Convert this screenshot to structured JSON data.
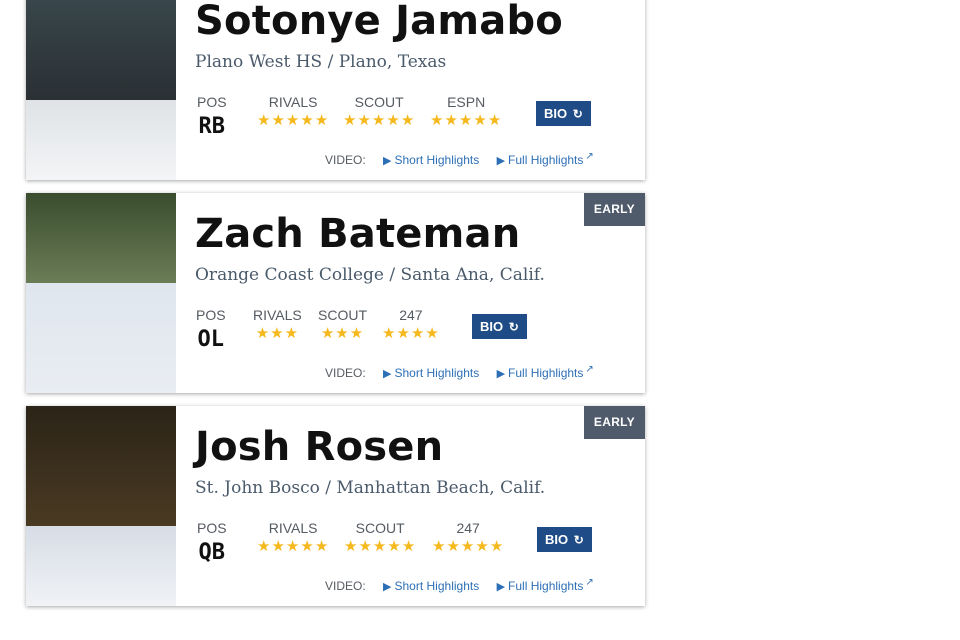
{
  "colors": {
    "badge_bg": "#4f5b6b",
    "bio_bg": "#1f4c87",
    "star": "#f5b81d",
    "link": "#2d6fb6",
    "school_text": "#4a5a6b"
  },
  "icons": {
    "star": "★",
    "refresh": "↻",
    "video_camera": "▶",
    "external_link": "↗"
  },
  "video_label": "VIDEO:",
  "players": [
    {
      "name": "Sotonye Jamabo",
      "school": "Plano West HS / Plano, Texas",
      "badge": "",
      "pos_label": "POS",
      "pos": "RB",
      "ratings": [
        {
          "label": "RIVALS",
          "stars": 5
        },
        {
          "label": "SCOUT",
          "stars": 5
        },
        {
          "label": "ESPN",
          "stars": 5
        }
      ],
      "bio_label": "BIO",
      "short_highlights": "Short Highlights",
      "full_highlights": "Full Highlights"
    },
    {
      "name": "Zach Bateman",
      "school": "Orange Coast College / Santa Ana, Calif.",
      "badge": "EARLY",
      "pos_label": "POS",
      "pos": "OL",
      "ratings": [
        {
          "label": "RIVALS",
          "stars": 3
        },
        {
          "label": "SCOUT",
          "stars": 3
        },
        {
          "label": "247",
          "stars": 4
        }
      ],
      "bio_label": "BIO",
      "short_highlights": "Short Highlights",
      "full_highlights": "Full Highlights"
    },
    {
      "name": "Josh Rosen",
      "school": "St. John Bosco / Manhattan Beach, Calif.",
      "badge": "EARLY",
      "pos_label": "POS",
      "pos": "QB",
      "ratings": [
        {
          "label": "RIVALS",
          "stars": 5
        },
        {
          "label": "SCOUT",
          "stars": 5
        },
        {
          "label": "247",
          "stars": 5
        }
      ],
      "bio_label": "BIO",
      "short_highlights": "Short Highlights",
      "full_highlights": "Full Highlights"
    }
  ]
}
